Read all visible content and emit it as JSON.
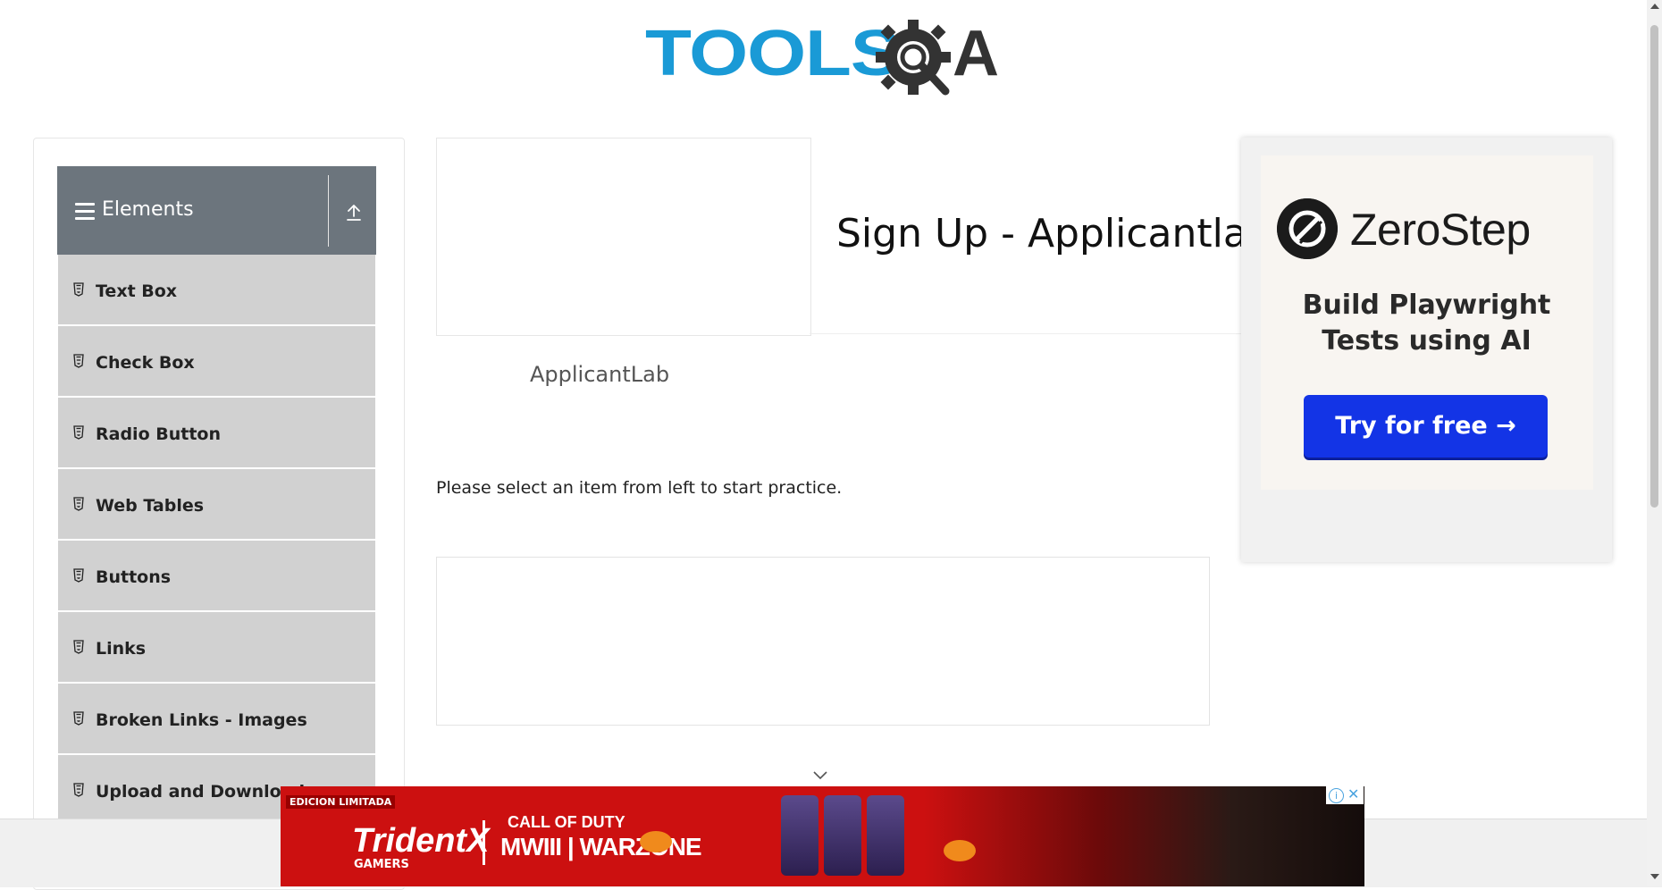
{
  "header": {
    "logo_text_left": "TOOLS",
    "logo_text_right": "A",
    "logo_icon": "gear-magnifier-icon"
  },
  "sidebar": {
    "group_title": "Elements",
    "group_icon": "hamburger-icon",
    "toggle_icon": "collapse-arrow-icon",
    "items": [
      {
        "label": "Text Box"
      },
      {
        "label": "Check Box"
      },
      {
        "label": "Radio Button"
      },
      {
        "label": "Web Tables"
      },
      {
        "label": "Buttons"
      },
      {
        "label": "Links"
      },
      {
        "label": "Broken Links - Images"
      },
      {
        "label": "Upload and Download"
      }
    ]
  },
  "main": {
    "title": "Sign Up - Applicantlab",
    "subtitle": "ApplicantLab",
    "prompt": "Please select an item from left to start practice."
  },
  "ad_right": {
    "brand": "ZeroStep",
    "tagline_line1": "Build Playwright",
    "tagline_line2": "Tests using AI",
    "cta": "Try for free →"
  },
  "ad_bottom": {
    "badge": "EDICION LIMITADA",
    "brand1": "TridentX",
    "brand1_sub": "GAMERS",
    "brand2_top": "CALL OF DUTY",
    "brand2_bottom": "MWIII | WARZONE",
    "info_icon": "info-icon",
    "close_icon": "close-icon"
  },
  "colors": {
    "logo_blue": "#1a9ad6",
    "sidebar_header": "#6c757d",
    "menu_item_bg": "#d1d1d1",
    "cta_blue": "#1334e6",
    "banner_red": "#cc1010"
  }
}
